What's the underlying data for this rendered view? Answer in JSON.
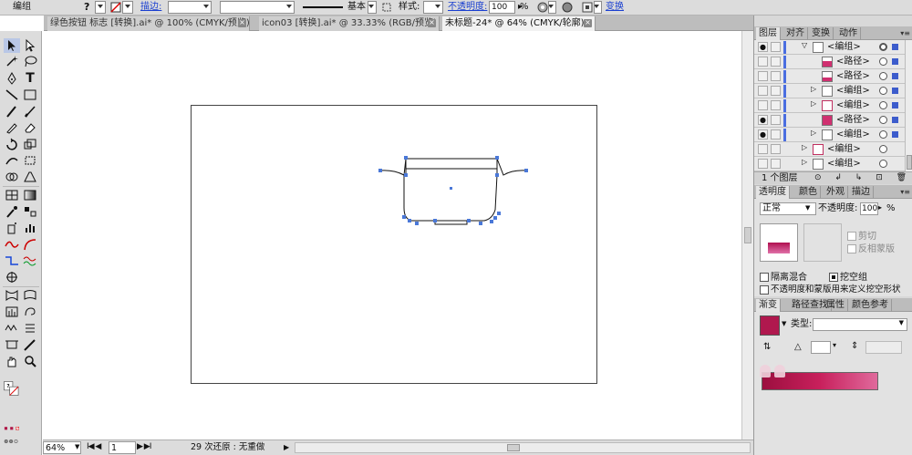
{
  "control_bar": {
    "selection_label": "编组",
    "fill_icon": "question-mark-fill-icon",
    "stroke_label": "描边:",
    "stroke_profile": "基本",
    "style_label": "样式:",
    "opacity_label": "不透明度:",
    "opacity_value": "100",
    "opacity_unit": "%",
    "transform_label": "变换"
  },
  "tabs": [
    {
      "label": "绿色按钮 标志 [转换].ai* @ 100% (CMYK/预览)",
      "active": false
    },
    {
      "label": "icon03 [转换].ai* @ 33.33% (RGB/预览)",
      "active": false
    },
    {
      "label": "未标题-24* @ 64% (CMYK/轮廓)",
      "active": true
    }
  ],
  "status_bar": {
    "zoom": "64%",
    "artboard_number": "1",
    "status_text": "29 次还原 : 无重做"
  },
  "layers_panel": {
    "tabs": [
      "图层",
      "对齐",
      "变换",
      "动作"
    ],
    "rows": [
      {
        "name": "<编组>",
        "eye": true
      },
      {
        "name": "<路径>",
        "eye": false
      },
      {
        "name": "<路径>",
        "eye": false
      },
      {
        "name": "<编组>",
        "eye": false
      },
      {
        "name": "<编组>",
        "eye": false
      },
      {
        "name": "<路径>",
        "eye": true
      },
      {
        "name": "<编组>",
        "eye": true
      },
      {
        "name": "<编组>",
        "eye": false
      },
      {
        "name": "<编组>",
        "eye": false
      }
    ],
    "footer_label": "1 个图层"
  },
  "transparency_panel": {
    "tabs": [
      "透明度",
      "颜色",
      "外观",
      "描边"
    ],
    "blend_mode": "正常",
    "opacity_label": "不透明度:",
    "opacity_value": "100",
    "opacity_unit": "%",
    "clip_label": "剪切",
    "invert_label": "反相蒙版",
    "isolate_label": "隔离混合",
    "knockout_label": "挖空组",
    "mask_define_label": "不透明度和蒙版用来定义挖空形状"
  },
  "gradient_panel": {
    "tabs": [
      "渐变",
      "路径查找",
      "属性",
      "颜色参考"
    ],
    "type_label": "类型:",
    "swatch_color": "#b0184e"
  },
  "colors": {
    "accent_blue": "#3c5ccc",
    "selection_blue": "#4a78d8",
    "gradient_start": "#9c0f3f",
    "gradient_mid": "#c8205c",
    "gradient_end": "#e06a9c"
  }
}
